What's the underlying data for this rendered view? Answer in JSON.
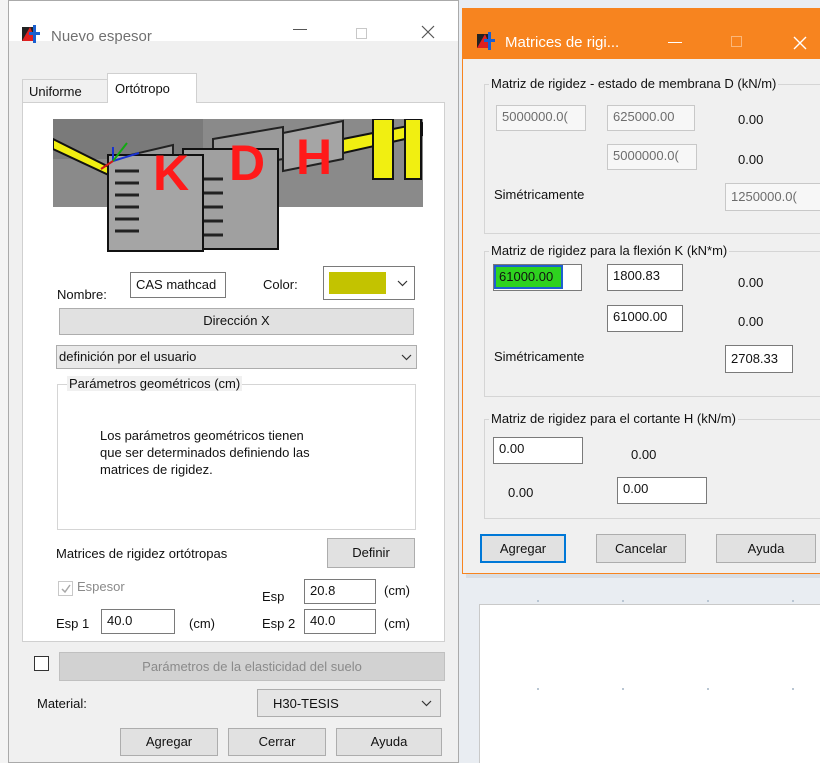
{
  "left_window": {
    "title": "Nuevo espesor",
    "tabs": [
      "Uniforme",
      "Ortótropo"
    ],
    "preview_letters": [
      "K",
      "D",
      "H"
    ],
    "nombre_label": "Nombre:",
    "nombre_value": "CAS mathcad",
    "color_label": "Color:",
    "color_hex": "#c3c300",
    "direction_button": "Dirección X",
    "definition_select": "definición por el usuario",
    "geo_group_title": "Parámetros geométricos (cm)",
    "geo_text": [
      "Los parámetros geométricos tienen",
      "que ser determinados definiendo las",
      "matrices de rigidez."
    ],
    "orto_label": "Matrices de rigidez ortótropas",
    "definir_button": "Definir",
    "espesor_label": "Espesor",
    "esp_label": "Esp",
    "esp_value": "20.8",
    "esp1_label": "Esp 1",
    "esp1_value": "40.0",
    "esp2_label": "Esp 2",
    "esp2_value": "40.0",
    "cm_unit": "(cm)",
    "soil_button": "Parámetros de la elasticidad del suelo",
    "material_label": "Material:",
    "material_value": "H30-TESIS",
    "btn_agregar": "Agregar",
    "btn_cerrar": "Cerrar",
    "btn_ayuda": "Ayuda"
  },
  "right_window": {
    "title": "Matrices de rigi...",
    "accent_hex": "#f7841f",
    "membrane": {
      "title": "Matriz de rigidez - estado de membrana D (kN/m)",
      "d11": "5000000.0(",
      "d12": "625000.00",
      "d13": "0.00",
      "d22": "5000000.0(",
      "d23": "0.00",
      "sym_label": "Simétricamente",
      "d33": "1250000.0("
    },
    "flexion": {
      "title": "Matriz de rigidez para la flexión K (kN*m)",
      "k11": "61000.00",
      "k12": "1800.83",
      "k13": "0.00",
      "k22": "61000.00",
      "k23": "0.00",
      "sym_label": "Simétricamente",
      "k33": "2708.33"
    },
    "cortante": {
      "title": "Matriz de rigidez para el cortante H (kN/m)",
      "h11": "0.00",
      "h12": "0.00",
      "h21": "0.00",
      "h22": "0.00"
    },
    "btn_agregar": "Agregar",
    "btn_cancelar": "Cancelar",
    "btn_ayuda": "Ayuda"
  }
}
